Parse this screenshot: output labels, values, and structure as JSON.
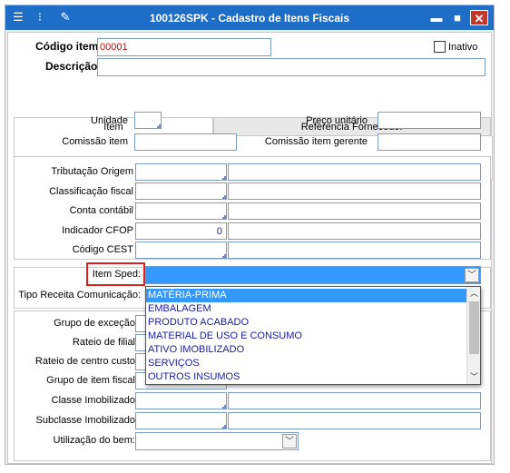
{
  "window": {
    "title": "100126SPK - Cadastro de Itens Fiscais"
  },
  "titlebar": {
    "menu_icon": "menu-icon",
    "traffic_icon": "traffic-light-icon",
    "tool_icon": "wrench-icon",
    "minimize": "▬",
    "maximize": "■",
    "close": "✕"
  },
  "header": {
    "codigo_label": "Código item",
    "codigo_value": "00001",
    "descricao_label": "Descrição",
    "descricao_value": "",
    "inativo_label": "Inativo",
    "inativo_checked": false
  },
  "tabs": [
    {
      "label": "Item"
    },
    {
      "label": "Referencia Fornecedor"
    }
  ],
  "item": {
    "unidade_label": "Unidade",
    "preco_label": "Preço unitário",
    "comissao_label": "Comissão item",
    "comissao_gerente_label": "Comissão item gerente"
  },
  "fiscal": {
    "trib_origem_label": "Tributação Origem",
    "class_fiscal_label": "Classificação fiscal",
    "conta_contabil_label": "Conta contábil",
    "indicador_cfop_label": "Indicador CFOP",
    "indicador_cfop_value": "0",
    "codigo_cest_label": "Código CEST"
  },
  "sped": {
    "item_sped_label": "Item Sped:",
    "tipo_receita_label": "Tipo Receita Comunicação:",
    "options": [
      "MATÉRIA-PRIMA",
      "EMBALAGEM",
      "PRODUTO ACABADO",
      "MATERIAL DE USO E CONSUMO",
      "ATIVO IMOBILIZADO",
      "SERVIÇOS",
      "OUTROS INSUMOS"
    ],
    "highlighted_index": 0
  },
  "lower": {
    "grupo_excecao_label": "Grupo de exceção",
    "rateio_filial_label": "Rateio de filial",
    "rateio_centro_label": "Rateio de centro custo",
    "grupo_item_fiscal_label": "Grupo de item fiscal",
    "classe_imob_label": "Classe Imobilizado",
    "subclasse_imob_label": "Subclasse Imobilizado",
    "utilizacao_label": "Utilização do bem:"
  },
  "colors": {
    "titlebar": "#1e6ec8",
    "selection": "#3399ff",
    "highlight_box": "#e02020",
    "code_text": "#d00000"
  }
}
